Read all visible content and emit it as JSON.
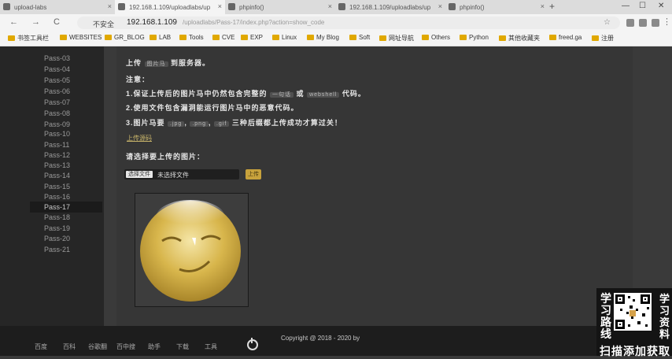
{
  "browser": {
    "tabs": [
      {
        "title": "upload-labs",
        "active": false
      },
      {
        "title": "192.168.1.109/uploadlabs/up",
        "active": true
      },
      {
        "title": "phpinfo()",
        "active": false
      },
      {
        "title": "192.168.1.109/uploadlabs/up",
        "active": false
      },
      {
        "title": "phpinfo()",
        "active": false
      }
    ],
    "new_tab": "+",
    "window_controls": {
      "minimize": "—",
      "maximize": "☐",
      "close": "✕"
    },
    "nav": {
      "back": "←",
      "forward": "→",
      "reload": "C"
    },
    "security_label": "不安全",
    "url": "192.168.1.109",
    "url_path": "/uploadlabs/Pass-17/index.php?action=show_code"
  },
  "bookmarks": [
    "书签工具栏",
    "WEBSITES",
    "GR_BLOG",
    "LAB",
    "Tools",
    "CVE",
    "EXP",
    "Linux",
    "My Blog",
    "Soft",
    "网址导航",
    "Others",
    "Python",
    "其他收藏夹",
    "freed.ga",
    "注册"
  ],
  "sidebar": {
    "items": [
      "Pass-03",
      "Pass-04",
      "Pass-05",
      "Pass-06",
      "Pass-07",
      "Pass-08",
      "Pass-09",
      "Pass-10",
      "Pass-11",
      "Pass-12",
      "Pass-13",
      "Pass-14",
      "Pass-15",
      "Pass-16",
      "Pass-17",
      "Pass-18",
      "Pass-19",
      "Pass-20",
      "Pass-21"
    ],
    "active": "Pass-17"
  },
  "main": {
    "task_prefix": "上传",
    "task_code": "图片马",
    "task_suffix": "到服务器。",
    "notice_title": "注意：",
    "note1_a": "1.保证上传后的图片马中仍然包含完整的",
    "note1_code1": "一句话",
    "note1_or": "或",
    "note1_code2": "webshell",
    "note1_b": "代码。",
    "note2_a": "2.使用文件包含漏洞能运行图片马中的恶意代码。",
    "note3_a": "3.图片马要",
    "note3_code1": ".jpg",
    "note3_code2": ".png",
    "note3_code3": ".gif",
    "note3_b": "三种后缀都上传成功才算过关！",
    "show_code": "上传源码",
    "select_label": "请选择要上传的图片：",
    "choose_btn": "选择文件",
    "no_file": "未选择文件",
    "upload_btn": "上传"
  },
  "footer": {
    "copyright": "Copyright @ 2018 - 2020 by",
    "taskbar": [
      "百度",
      "百科",
      "谷歌翻",
      "百中搜",
      "助手",
      "下载",
      "工具"
    ]
  },
  "overlay": {
    "left_text": "学习路线",
    "right_text": "学习资料",
    "bottom_text": "扫描添加获取"
  },
  "colors": {
    "accent": "#c8a23c",
    "sidebar_bg": "#262626",
    "main_bg": "#363636"
  }
}
